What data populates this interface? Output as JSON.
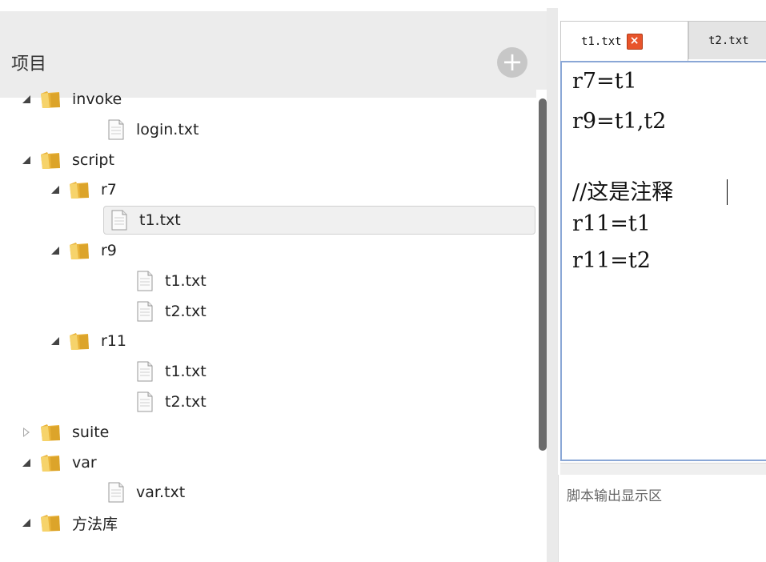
{
  "project_panel": {
    "title": "项目",
    "add_button_symbol": "+"
  },
  "tree": [
    {
      "label": "invoke",
      "type": "folder",
      "expanded": true,
      "depth": 0
    },
    {
      "label": "login.txt",
      "type": "file",
      "depth": 1
    },
    {
      "label": "script",
      "type": "folder",
      "expanded": true,
      "depth": 0
    },
    {
      "label": "r7",
      "type": "folder",
      "expanded": true,
      "depth": 1
    },
    {
      "label": "t1.txt",
      "type": "file",
      "depth": 2,
      "selected": true
    },
    {
      "label": "r9",
      "type": "folder",
      "expanded": true,
      "depth": 1
    },
    {
      "label": "t1.txt",
      "type": "file",
      "depth": 2
    },
    {
      "label": "t2.txt",
      "type": "file",
      "depth": 2
    },
    {
      "label": "r11",
      "type": "folder",
      "expanded": true,
      "depth": 1
    },
    {
      "label": "t1.txt",
      "type": "file",
      "depth": 2
    },
    {
      "label": "t2.txt",
      "type": "file",
      "depth": 2
    },
    {
      "label": "suite",
      "type": "folder",
      "expanded": false,
      "depth": 0
    },
    {
      "label": "var",
      "type": "folder",
      "expanded": true,
      "depth": 0
    },
    {
      "label": "var.txt",
      "type": "file",
      "depth": 1
    },
    {
      "label": "方法库",
      "type": "folder",
      "expanded": true,
      "depth": 0
    }
  ],
  "editor": {
    "tabs": [
      {
        "label": "t1.txt",
        "active": true,
        "closable": true
      },
      {
        "label": "t2.txt",
        "active": false
      }
    ],
    "lines": [
      "r7=t1",
      "r9=t1,t2",
      "",
      "//这是注释",
      "r11=t1",
      "r11=t2"
    ]
  },
  "output": {
    "placeholder": "脚本输出显示区"
  },
  "colors": {
    "header_bg": "#ececec",
    "editor_border": "#8aa7d6",
    "close_button": "#e8542b",
    "scroll_thumb": "#6b6b6b"
  }
}
